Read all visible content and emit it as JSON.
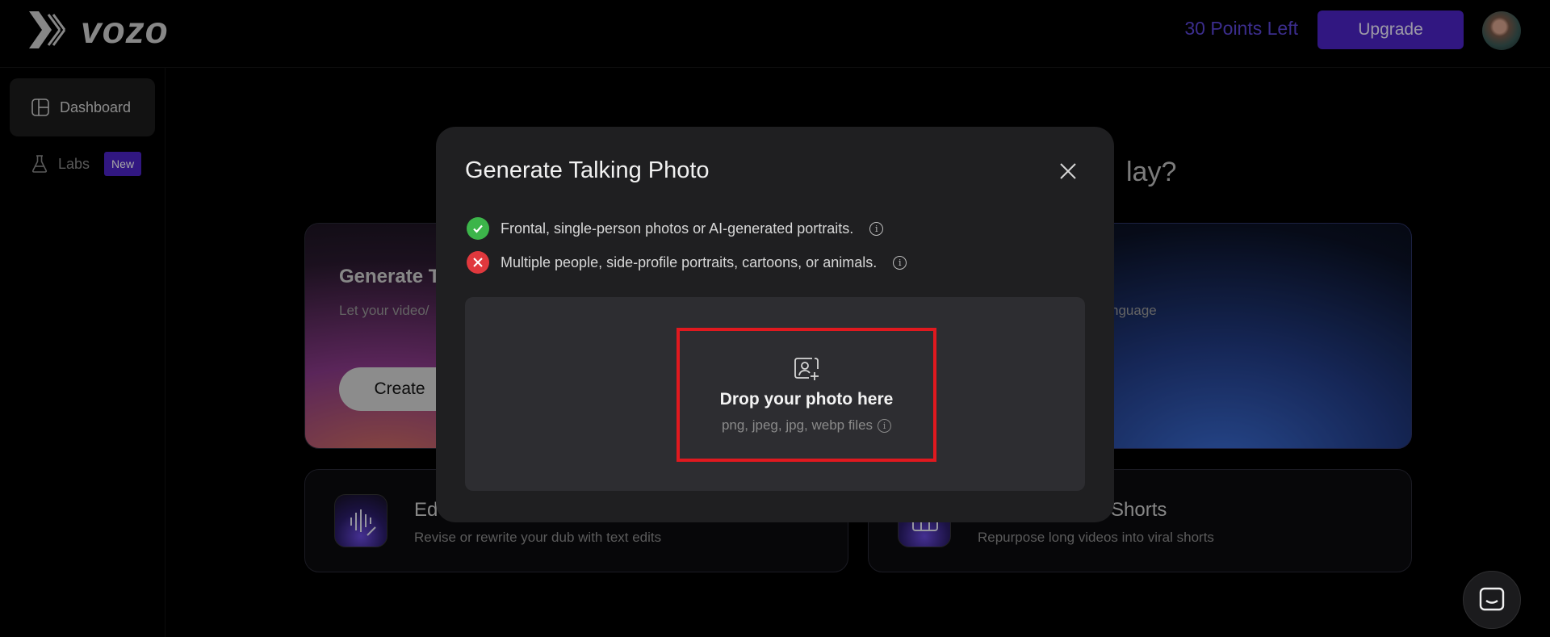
{
  "header": {
    "logo_text": "vozo",
    "points_text": "30 Points Left",
    "upgrade_label": "Upgrade"
  },
  "sidebar": {
    "items": [
      {
        "label": "Dashboard",
        "icon": "layout-icon"
      },
      {
        "label": "Labs",
        "icon": "flask-icon",
        "badge": "New"
      }
    ]
  },
  "background": {
    "heading_partial": "lay?",
    "cards": [
      {
        "title": "Generate T",
        "subtitle": "Let your video/",
        "button": "Create"
      },
      {
        "subtitle": "nguage"
      }
    ],
    "tiles": [
      {
        "title": "Ed",
        "subtitle": "Revise or rewrite your dub with text edits"
      },
      {
        "title": "Shorts",
        "subtitle": "Repurpose long videos into viral shorts"
      }
    ]
  },
  "modal": {
    "title": "Generate Talking Photo",
    "rules": {
      "ok": "Frontal, single-person photos or AI-generated portraits.",
      "bad": "Multiple people, side-profile portraits, cartoons, or animals."
    },
    "dropzone": {
      "title": "Drop your photo here",
      "formats": "png, jpeg, jpg, webp files"
    }
  },
  "colors": {
    "accent": "#4c24c7",
    "points": "#5b45d8",
    "ok": "#3cb54a",
    "bad": "#e0383d",
    "highlight": "#e0191f"
  }
}
